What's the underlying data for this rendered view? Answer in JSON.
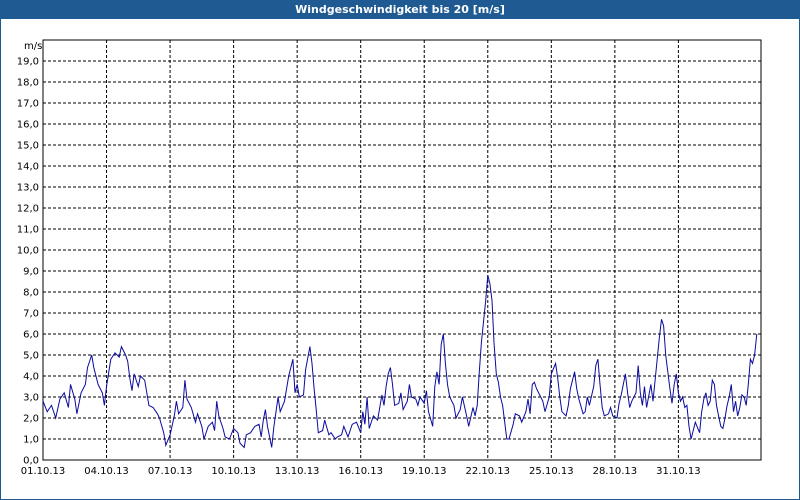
{
  "window": {
    "title": "Windgeschwindigkeit bis 20 [m/s]"
  },
  "colors": {
    "titlebar": "#1f5a93",
    "line": "#0a0aa0",
    "grid": "#000000"
  },
  "chart_data": {
    "type": "line",
    "title": "Windgeschwindigkeit bis 20 [m/s]",
    "ylabel": "m/s",
    "xlabel": "",
    "ylim": [
      0,
      20
    ],
    "xlim_days": [
      0,
      32.6
    ],
    "grid": true,
    "y_ticks": [
      "0,0",
      "1,0",
      "2,0",
      "3,0",
      "4,0",
      "5,0",
      "6,0",
      "7,0",
      "8,0",
      "9,0",
      "10,0",
      "11,0",
      "12,0",
      "13,0",
      "14,0",
      "15,0",
      "16,0",
      "17,0",
      "18,0",
      "19,0"
    ],
    "x_ticks": [
      "01.10.13",
      "04.10.13",
      "07.10.13",
      "10.10.13",
      "13.10.13",
      "16.10.13",
      "19.10.13",
      "22.10.13",
      "25.10.13",
      "28.10.13",
      "31.10.13"
    ],
    "series": [
      {
        "points": [
          [
            0.0,
            2.8
          ],
          [
            0.2,
            2.3
          ],
          [
            0.4,
            2.6
          ],
          [
            0.6,
            2.0
          ],
          [
            0.8,
            2.9
          ],
          [
            1.0,
            3.2
          ],
          [
            1.2,
            2.5
          ],
          [
            1.3,
            3.6
          ],
          [
            1.5,
            2.9
          ],
          [
            1.6,
            2.2
          ],
          [
            1.8,
            3.2
          ],
          [
            2.0,
            3.6
          ],
          [
            2.1,
            4.4
          ],
          [
            2.3,
            5.0
          ],
          [
            2.4,
            4.4
          ],
          [
            2.6,
            3.6
          ],
          [
            2.8,
            3.2
          ],
          [
            2.9,
            2.6
          ],
          [
            3.0,
            3.5
          ],
          [
            3.2,
            4.8
          ],
          [
            3.4,
            5.1
          ],
          [
            3.6,
            4.9
          ],
          [
            3.7,
            5.4
          ],
          [
            3.9,
            5.0
          ],
          [
            4.0,
            4.7
          ],
          [
            4.1,
            3.9
          ],
          [
            4.2,
            3.3
          ],
          [
            4.3,
            4.1
          ],
          [
            4.5,
            3.5
          ],
          [
            4.6,
            4.0
          ],
          [
            4.8,
            3.8
          ],
          [
            4.9,
            3.2
          ],
          [
            5.0,
            2.6
          ],
          [
            5.2,
            2.5
          ],
          [
            5.4,
            2.2
          ],
          [
            5.5,
            2.0
          ],
          [
            5.7,
            1.3
          ],
          [
            5.8,
            0.7
          ],
          [
            6.0,
            1.2
          ],
          [
            6.2,
            2.1
          ],
          [
            6.3,
            2.8
          ],
          [
            6.4,
            2.2
          ],
          [
            6.6,
            2.5
          ],
          [
            6.7,
            3.8
          ],
          [
            6.8,
            2.9
          ],
          [
            7.0,
            2.5
          ],
          [
            7.2,
            1.8
          ],
          [
            7.3,
            2.2
          ],
          [
            7.5,
            1.6
          ],
          [
            7.6,
            1.0
          ],
          [
            7.8,
            1.6
          ],
          [
            8.0,
            1.8
          ],
          [
            8.1,
            1.4
          ],
          [
            8.2,
            2.8
          ],
          [
            8.3,
            2.1
          ],
          [
            8.5,
            1.5
          ],
          [
            8.6,
            1.1
          ],
          [
            8.8,
            1.0
          ],
          [
            9.0,
            1.5
          ],
          [
            9.2,
            1.3
          ],
          [
            9.3,
            0.8
          ],
          [
            9.5,
            0.6
          ],
          [
            9.6,
            1.2
          ],
          [
            9.8,
            1.3
          ],
          [
            10.0,
            1.6
          ],
          [
            10.2,
            1.7
          ],
          [
            10.3,
            1.1
          ],
          [
            10.4,
            1.9
          ],
          [
            10.5,
            2.4
          ],
          [
            10.6,
            1.6
          ],
          [
            10.8,
            0.6
          ],
          [
            10.9,
            1.6
          ],
          [
            11.1,
            3.0
          ],
          [
            11.2,
            2.3
          ],
          [
            11.4,
            2.8
          ],
          [
            11.5,
            3.4
          ],
          [
            11.6,
            4.0
          ],
          [
            11.8,
            4.8
          ],
          [
            11.9,
            3.2
          ],
          [
            12.0,
            3.6
          ],
          [
            12.1,
            3.0
          ],
          [
            12.3,
            3.1
          ],
          [
            12.4,
            4.3
          ],
          [
            12.6,
            5.4
          ],
          [
            12.7,
            4.6
          ],
          [
            12.8,
            3.4
          ],
          [
            12.9,
            2.4
          ],
          [
            13.0,
            1.3
          ],
          [
            13.2,
            1.4
          ],
          [
            13.3,
            1.9
          ],
          [
            13.5,
            1.2
          ],
          [
            13.6,
            1.3
          ],
          [
            13.8,
            1.0
          ],
          [
            13.9,
            1.1
          ],
          [
            14.1,
            1.2
          ],
          [
            14.2,
            1.6
          ],
          [
            14.4,
            1.1
          ],
          [
            14.5,
            1.4
          ],
          [
            14.6,
            1.7
          ],
          [
            14.8,
            1.8
          ],
          [
            15.0,
            1.3
          ],
          [
            15.1,
            2.3
          ],
          [
            15.2,
            1.7
          ],
          [
            15.3,
            3.0
          ],
          [
            15.4,
            1.5
          ],
          [
            15.6,
            2.1
          ],
          [
            15.8,
            1.9
          ],
          [
            16.0,
            3.1
          ],
          [
            16.1,
            2.6
          ],
          [
            16.2,
            3.5
          ],
          [
            16.3,
            4.1
          ],
          [
            16.4,
            4.4
          ],
          [
            16.5,
            3.6
          ],
          [
            16.6,
            2.6
          ],
          [
            16.8,
            2.7
          ],
          [
            16.9,
            3.2
          ],
          [
            17.0,
            2.4
          ],
          [
            17.2,
            2.8
          ],
          [
            17.3,
            3.6
          ],
          [
            17.4,
            3.0
          ],
          [
            17.6,
            2.9
          ],
          [
            17.7,
            2.6
          ],
          [
            17.8,
            3.0
          ],
          [
            18.0,
            2.7
          ],
          [
            18.1,
            3.3
          ],
          [
            18.2,
            2.3
          ],
          [
            18.4,
            1.6
          ],
          [
            18.5,
            3.5
          ],
          [
            18.6,
            4.2
          ],
          [
            18.7,
            3.6
          ],
          [
            18.8,
            5.5
          ],
          [
            18.9,
            6.0
          ],
          [
            19.0,
            4.6
          ],
          [
            19.1,
            3.6
          ],
          [
            19.2,
            3.0
          ],
          [
            19.4,
            2.6
          ],
          [
            19.5,
            2.0
          ],
          [
            19.7,
            2.4
          ],
          [
            19.8,
            3.0
          ],
          [
            20.0,
            2.1
          ],
          [
            20.1,
            1.6
          ],
          [
            20.3,
            2.5
          ],
          [
            20.4,
            2.1
          ],
          [
            20.5,
            2.6
          ],
          [
            20.6,
            4.2
          ],
          [
            20.7,
            5.6
          ],
          [
            20.9,
            7.6
          ],
          [
            21.0,
            8.8
          ],
          [
            21.1,
            8.4
          ],
          [
            21.2,
            7.6
          ],
          [
            21.3,
            5.5
          ],
          [
            21.4,
            4.1
          ],
          [
            21.5,
            3.7
          ],
          [
            21.6,
            3.0
          ],
          [
            21.7,
            2.6
          ],
          [
            21.8,
            1.8
          ],
          [
            21.9,
            1.0
          ],
          [
            22.0,
            1.0
          ],
          [
            22.2,
            1.7
          ],
          [
            22.3,
            2.2
          ],
          [
            22.5,
            2.1
          ],
          [
            22.6,
            1.8
          ],
          [
            22.8,
            2.3
          ],
          [
            22.9,
            2.9
          ],
          [
            23.0,
            2.2
          ],
          [
            23.1,
            3.6
          ],
          [
            23.2,
            3.7
          ],
          [
            23.3,
            3.4
          ],
          [
            23.5,
            3.0
          ],
          [
            23.6,
            2.8
          ],
          [
            23.7,
            2.3
          ],
          [
            23.9,
            3.0
          ],
          [
            24.0,
            4.1
          ],
          [
            24.2,
            4.6
          ],
          [
            24.3,
            3.9
          ],
          [
            24.4,
            3.0
          ],
          [
            24.5,
            2.3
          ],
          [
            24.7,
            2.1
          ],
          [
            24.8,
            2.6
          ],
          [
            24.9,
            3.4
          ],
          [
            25.1,
            4.2
          ],
          [
            25.2,
            3.4
          ],
          [
            25.3,
            2.9
          ],
          [
            25.5,
            2.2
          ],
          [
            25.6,
            2.3
          ],
          [
            25.7,
            3.0
          ],
          [
            25.8,
            2.6
          ],
          [
            26.0,
            3.5
          ],
          [
            26.1,
            4.5
          ],
          [
            26.2,
            4.8
          ],
          [
            26.3,
            3.6
          ],
          [
            26.4,
            2.5
          ],
          [
            26.5,
            2.1
          ],
          [
            26.7,
            2.2
          ],
          [
            26.8,
            2.5
          ],
          [
            26.9,
            2.1
          ],
          [
            27.1,
            2.0
          ],
          [
            27.2,
            2.7
          ],
          [
            27.3,
            3.1
          ],
          [
            27.4,
            3.6
          ],
          [
            27.5,
            4.1
          ],
          [
            27.6,
            3.2
          ],
          [
            27.7,
            2.5
          ],
          [
            27.8,
            2.8
          ],
          [
            28.0,
            3.2
          ],
          [
            28.1,
            4.5
          ],
          [
            28.2,
            3.2
          ],
          [
            28.3,
            2.6
          ],
          [
            28.4,
            3.5
          ],
          [
            28.5,
            2.5
          ],
          [
            28.7,
            3.6
          ],
          [
            28.8,
            2.8
          ],
          [
            28.9,
            3.8
          ],
          [
            29.0,
            4.8
          ],
          [
            29.1,
            5.8
          ],
          [
            29.2,
            6.7
          ],
          [
            29.3,
            6.4
          ],
          [
            29.4,
            5.0
          ],
          [
            29.5,
            4.2
          ],
          [
            29.6,
            3.4
          ],
          [
            29.7,
            2.7
          ],
          [
            29.8,
            3.6
          ],
          [
            29.9,
            4.1
          ],
          [
            30.0,
            3.2
          ],
          [
            30.1,
            2.8
          ],
          [
            30.2,
            3.0
          ],
          [
            30.3,
            2.5
          ],
          [
            30.4,
            2.6
          ],
          [
            30.5,
            1.6
          ],
          [
            30.6,
            1.0
          ],
          [
            30.7,
            1.4
          ],
          [
            30.8,
            1.8
          ],
          [
            31.0,
            1.3
          ],
          [
            31.1,
            2.3
          ],
          [
            31.2,
            2.9
          ],
          [
            31.3,
            3.2
          ],
          [
            31.4,
            2.6
          ],
          [
            31.5,
            2.8
          ],
          [
            31.6,
            3.8
          ],
          [
            31.7,
            3.6
          ],
          [
            31.8,
            2.6
          ],
          [
            31.9,
            2.1
          ],
          [
            32.0,
            1.6
          ],
          [
            32.1,
            1.5
          ],
          [
            32.2,
            2.0
          ],
          [
            32.3,
            2.6
          ],
          [
            32.4,
            3.0
          ],
          [
            32.5,
            3.6
          ],
          [
            32.6,
            2.3
          ],
          [
            32.7,
            2.8
          ],
          [
            32.8,
            2.1
          ],
          [
            32.9,
            2.5
          ],
          [
            33.0,
            3.1
          ],
          [
            33.1,
            3.0
          ],
          [
            33.2,
            2.6
          ],
          [
            33.3,
            3.6
          ],
          [
            33.4,
            4.8
          ],
          [
            33.5,
            4.6
          ],
          [
            33.6,
            5.0
          ],
          [
            33.7,
            6.0
          ]
        ]
      }
    ]
  }
}
